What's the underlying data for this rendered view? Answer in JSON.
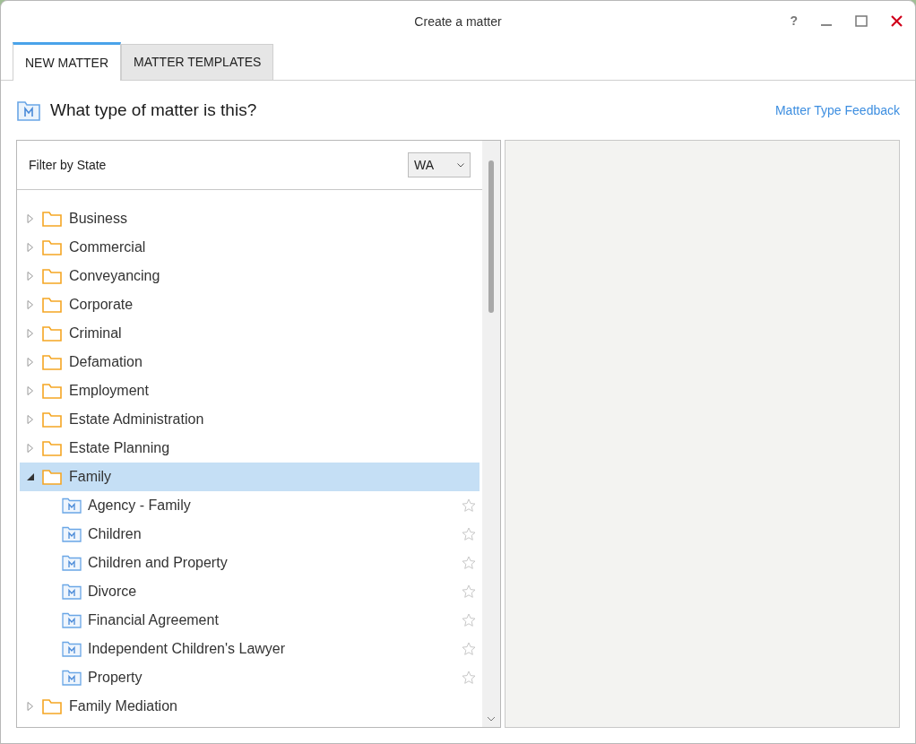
{
  "window": {
    "title": "Create a matter",
    "controls": [
      "?"
    ]
  },
  "tabs": [
    {
      "label": "NEW MATTER",
      "selected": true
    },
    {
      "label": "MATTER TEMPLATES",
      "selected": false
    }
  ],
  "heading": "What type of matter is this?",
  "feedback_link": "Matter Type Feedback",
  "filter": {
    "label": "Filter by State",
    "value": "WA"
  },
  "tree": [
    {
      "label": "Business",
      "expanded": false,
      "selected": false
    },
    {
      "label": "Commercial",
      "expanded": false,
      "selected": false
    },
    {
      "label": "Conveyancing",
      "expanded": false,
      "selected": false
    },
    {
      "label": "Corporate",
      "expanded": false,
      "selected": false
    },
    {
      "label": "Criminal",
      "expanded": false,
      "selected": false
    },
    {
      "label": "Defamation",
      "expanded": false,
      "selected": false
    },
    {
      "label": "Employment",
      "expanded": false,
      "selected": false
    },
    {
      "label": "Estate Administration",
      "expanded": false,
      "selected": false
    },
    {
      "label": "Estate Planning",
      "expanded": false,
      "selected": false
    },
    {
      "label": "Family",
      "expanded": true,
      "selected": true,
      "children": [
        {
          "label": "Agency - Family",
          "favorite": false
        },
        {
          "label": "Children",
          "favorite": false
        },
        {
          "label": "Children and Property",
          "favorite": false
        },
        {
          "label": "Divorce",
          "favorite": false
        },
        {
          "label": "Financial Agreement",
          "favorite": false
        },
        {
          "label": "Independent Children's Lawyer",
          "favorite": false
        },
        {
          "label": "Property",
          "favorite": false
        }
      ]
    },
    {
      "label": "Family Mediation",
      "expanded": false,
      "selected": false
    }
  ]
}
